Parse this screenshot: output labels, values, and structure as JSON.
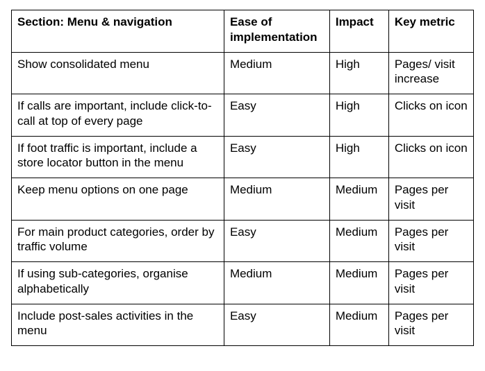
{
  "table": {
    "headers": {
      "section": "Section: Menu & navigation",
      "ease": "Ease of implementation",
      "impact": "Impact",
      "metric": "Key metric"
    },
    "rows": [
      {
        "section": "Show consolidated menu",
        "ease": "Medium",
        "impact": "High",
        "metric": "Pages/ visit increase"
      },
      {
        "section": "If calls are important, include click-to-call at top of every page",
        "ease": "Easy",
        "impact": "High",
        "metric": "Clicks on icon"
      },
      {
        "section": "If foot traffic is important, include a store locator button in the menu",
        "ease": "Easy",
        "impact": "High",
        "metric": "Clicks on icon"
      },
      {
        "section": "Keep menu options on one page",
        "ease": "Medium",
        "impact": "Medium",
        "metric": "Pages per visit"
      },
      {
        "section": "For main product categories, order by traffic volume",
        "ease": "Easy",
        "impact": "Medium",
        "metric": "Pages per visit"
      },
      {
        "section": "If using sub-categories, organise alphabetically",
        "ease": "Medium",
        "impact": "Medium",
        "metric": "Pages per visit"
      },
      {
        "section": "Include post-sales activities in the menu",
        "ease": "Easy",
        "impact": "Medium",
        "metric": "Pages per visit"
      }
    ]
  }
}
